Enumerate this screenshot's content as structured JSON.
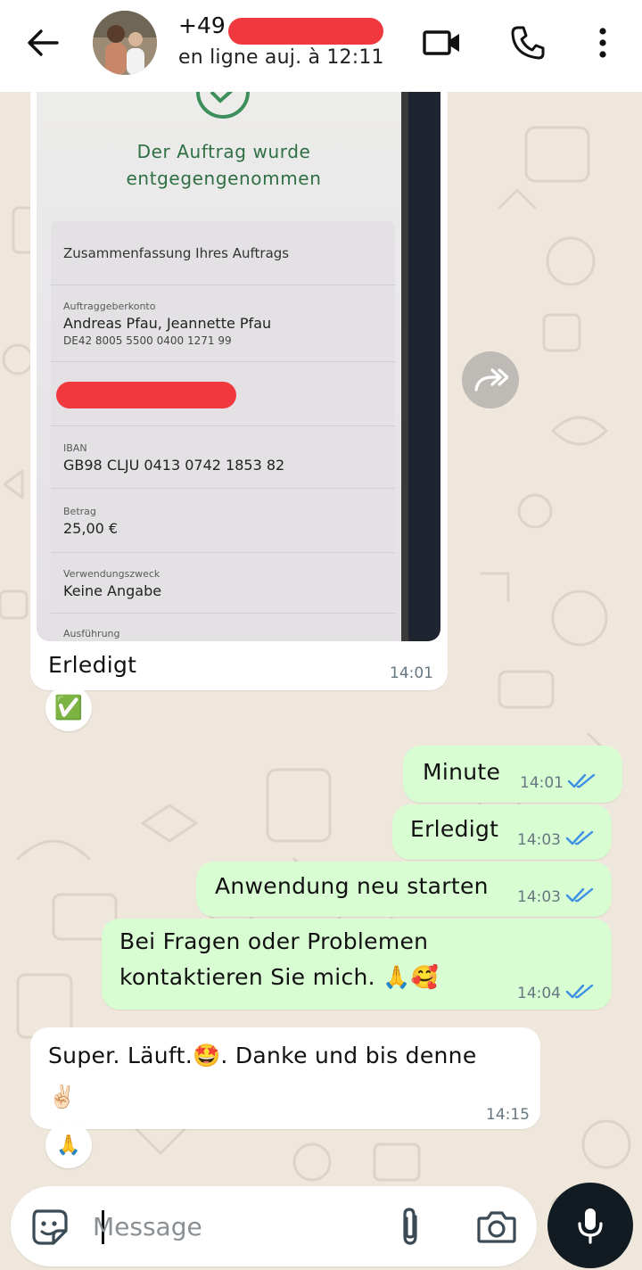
{
  "header": {
    "contact_name": "+49",
    "status": "en ligne auj. à 12:11",
    "back_icon": "arrow-left-icon",
    "video_icon": "video-camera-icon",
    "call_icon": "phone-icon",
    "menu_icon": "more-vertical-icon"
  },
  "photo_message": {
    "screenshot_title_line1": "Der Auftrag wurde",
    "screenshot_title_line2": "entgegengenommen",
    "summary_heading": "Zusammenfassung Ihres Auftrags",
    "payer_label": "Auftraggeberkonto",
    "payer_name": "Andreas Pfau, Jeannette Pfau",
    "payer_iban": "DE42 8005 5500 0400 1271 99",
    "iban_label": "IBAN",
    "iban_value": "GB98 CLJU 0413 0742 1853 82",
    "amount_label": "Betrag",
    "amount_value": "25,00 €",
    "purpose_label": "Verwendungszweck",
    "purpose_value": "Keine Angabe",
    "execution_label": "Ausführung",
    "caption": "Erledigt",
    "time": "14:01",
    "reaction": "✅"
  },
  "messages": [
    {
      "text": "Minute",
      "time": "14:01",
      "direction": "out"
    },
    {
      "text": "Erledigt",
      "time": "14:03",
      "direction": "out"
    },
    {
      "text": "Anwendung neu starten",
      "time": "14:03",
      "direction": "out"
    },
    {
      "text_line1": "Bei Fragen oder Problemen",
      "text_line2": "kontaktieren Sie mich. 🙏🥰",
      "time": "14:04",
      "direction": "out"
    },
    {
      "text_line1": "Super. Läuft.🤩. Danke und bis denne",
      "text_line2": "✌🏻",
      "time": "14:15",
      "direction": "in",
      "reaction": "🙏"
    }
  ],
  "composer": {
    "placeholder": "Message",
    "sticker_icon": "sticker-icon",
    "attach_icon": "paperclip-icon",
    "camera_icon": "camera-icon",
    "mic_icon": "microphone-icon"
  },
  "colors": {
    "outgoing_bubble": "#d9fdd3",
    "incoming_bubble": "#ffffff",
    "read_ticks": "#3b8fe4",
    "redaction": "#f0393e",
    "mic_button": "#111b21"
  }
}
